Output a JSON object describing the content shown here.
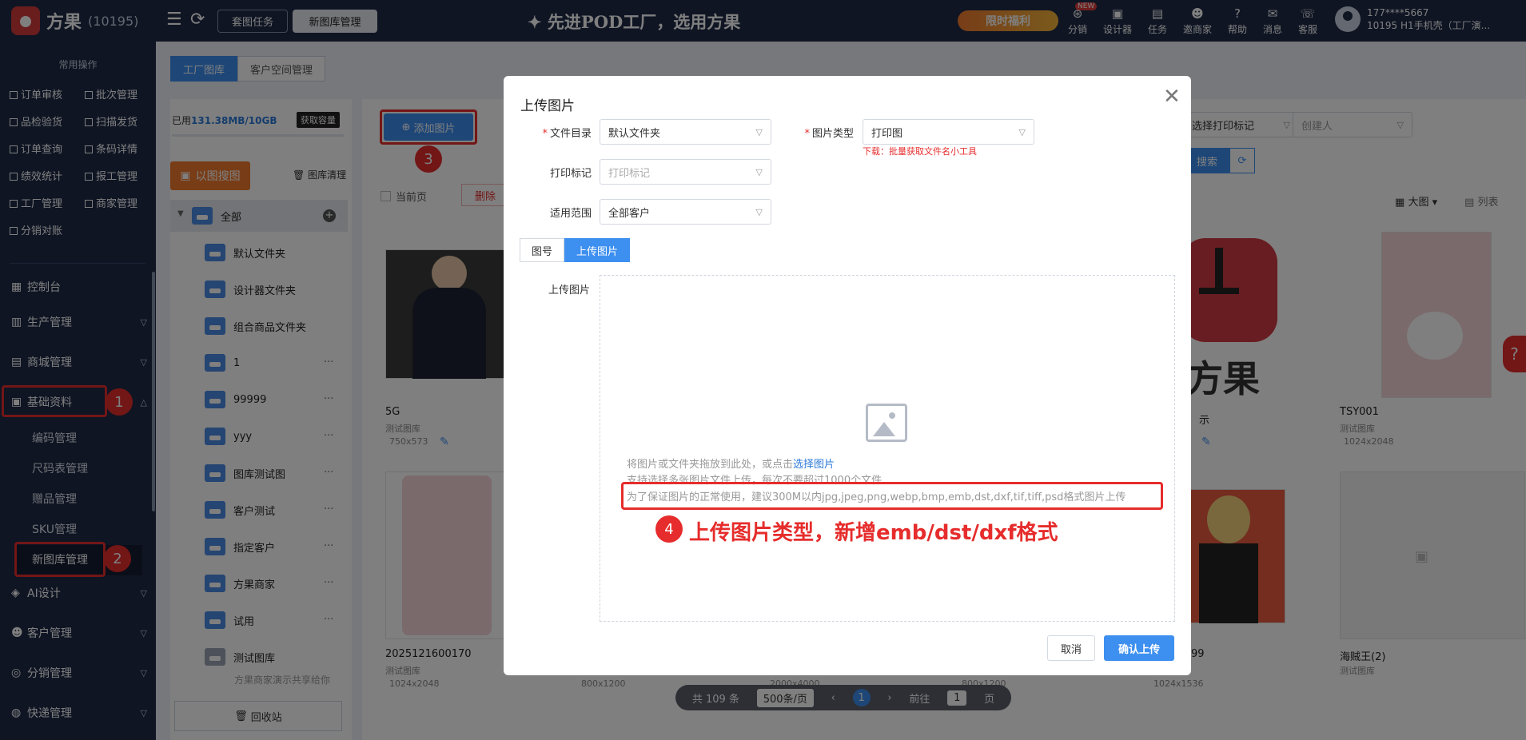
{
  "app": {
    "name": "方果",
    "id": "(10195)"
  },
  "topbar": {
    "tabs": [
      {
        "label": "套图任务"
      },
      {
        "label": "新图库管理"
      }
    ],
    "slogan": "✦ 先进POD工厂，选用方果",
    "welfare": "限时福利",
    "new_badge": "NEW",
    "nav": [
      {
        "label": "分销",
        "icon": "share-icon"
      },
      {
        "label": "设计器",
        "icon": "image-icon"
      },
      {
        "label": "任务",
        "icon": "task-icon"
      },
      {
        "label": "邀商家",
        "icon": "users-icon"
      },
      {
        "label": "帮助",
        "icon": "help-icon"
      },
      {
        "label": "消息",
        "icon": "message-icon"
      },
      {
        "label": "客服",
        "icon": "service-icon"
      }
    ],
    "user": {
      "phone": "177****5667",
      "org": "10195 H1手机壳（工厂演..."
    }
  },
  "sidebar": {
    "common_title": "常用操作",
    "quick": [
      [
        "订单审核",
        "批次管理"
      ],
      [
        "品检验货",
        "扫描发货"
      ],
      [
        "订单查询",
        "条码详情"
      ],
      [
        "绩效统计",
        "报工管理"
      ],
      [
        "工厂管理",
        "商家管理"
      ],
      [
        "分销对账",
        ""
      ]
    ],
    "menus": [
      {
        "label": "控制台",
        "icon": "dashboard-icon",
        "chevron": false
      },
      {
        "label": "生产管理",
        "icon": "factory-icon",
        "chevron": true
      },
      {
        "label": "商城管理",
        "icon": "shop-icon",
        "chevron": true
      },
      {
        "label": "基础资料",
        "icon": "database-icon",
        "chevron": true
      }
    ],
    "submenus": [
      "编码管理",
      "尺码表管理",
      "赠品管理",
      "SKU管理",
      "新图库管理"
    ],
    "menus2": [
      {
        "label": "AI设计",
        "icon": "ai-icon"
      },
      {
        "label": "客户管理",
        "icon": "customer-icon"
      },
      {
        "label": "分销管理",
        "icon": "distribution-icon"
      },
      {
        "label": "快递管理",
        "icon": "express-icon"
      }
    ],
    "annotations": [
      "1",
      "2"
    ]
  },
  "content": {
    "tabs": [
      "工厂图库",
      "客户空间管理"
    ],
    "usage_prefix": "已用",
    "usage_value": "131.38MB/10GB",
    "capacity_btn": "获取容量",
    "image_search_btn": "以图搜图",
    "clean_btn": "图库清理",
    "folders": [
      {
        "label": "全部"
      },
      {
        "label": "默认文件夹"
      },
      {
        "label": "设计器文件夹"
      },
      {
        "label": "组合商品文件夹"
      },
      {
        "label": "1"
      },
      {
        "label": "99999"
      },
      {
        "label": "yyy"
      },
      {
        "label": "图库测试图"
      },
      {
        "label": "客户测试"
      },
      {
        "label": "指定客户"
      },
      {
        "label": "方果商家"
      },
      {
        "label": "试用"
      },
      {
        "label": "测试图库"
      }
    ],
    "shared_note": "方果商家演示共享给你",
    "recycle_btn": "回收站",
    "add_image_btn": "添加图片",
    "annotation_3": "3",
    "current_page_cb": "当前页",
    "delete_btn": "删除",
    "filters": [
      "选择打印标记",
      "创建人"
    ],
    "search_btn": "搜索",
    "view_modes": [
      "大图",
      "列表"
    ],
    "grid": [
      {
        "name": "5G",
        "lib": "测试图库",
        "size": "750x573"
      },
      {
        "name": "",
        "lib": "",
        "size": ""
      },
      {
        "name": "TSY001",
        "lib": "测试图库",
        "size": "1024x2048"
      },
      {
        "name": "2025121600170",
        "lib": "测试图库",
        "size": "1024x2048"
      },
      {
        "name": "",
        "lib": "",
        "size": "800x1200"
      },
      {
        "name": "",
        "lib": "",
        "size": "2000x4000"
      },
      {
        "name": "",
        "lib": "",
        "size": "800x1200"
      },
      {
        "name": "99",
        "lib": "",
        "size": "1024x1536"
      },
      {
        "name": "海贼王(2)",
        "lib": "测试图库",
        "size": ""
      }
    ],
    "brand_text": "方果",
    "pager": {
      "total": "共 109 条",
      "per_page": "500条/页",
      "current": "1",
      "goto": "前往",
      "goto_val": "1",
      "page_unit": "页"
    }
  },
  "modal": {
    "title": "上传图片",
    "folder_label": "文件目录",
    "folder_value": "默认文件夹",
    "type_label": "图片类型",
    "type_value": "打印图",
    "download_tip": "下载：批量获取文件名小工具",
    "mark_label": "打印标记",
    "mark_placeholder": "打印标记",
    "scope_label": "适用范围",
    "scope_value": "全部客户",
    "seg": [
      "图号",
      "上传图片"
    ],
    "upload_label": "上传图片",
    "drop_text": "将图片或文件夹拖放到此处，或点击",
    "drop_link": "选择图片",
    "multi_text": "支持选择多张图片文件上传，每次不要超过1000个文件",
    "formats_text": "为了保证图片的正常使用，建议300M以内jpg,jpeg,png,webp,bmp,emb,dst,dxf,tif,tiff,psd格式图片上传",
    "annotation_4": "4",
    "annotation_text": "上传图片类型，新增emb/dst/dxf格式",
    "cancel": "取消",
    "confirm": "确认上传"
  },
  "colors": {
    "accent": "#3d8ff0",
    "annotation": "#e62c2c",
    "sidebar": "#1e2a47"
  }
}
